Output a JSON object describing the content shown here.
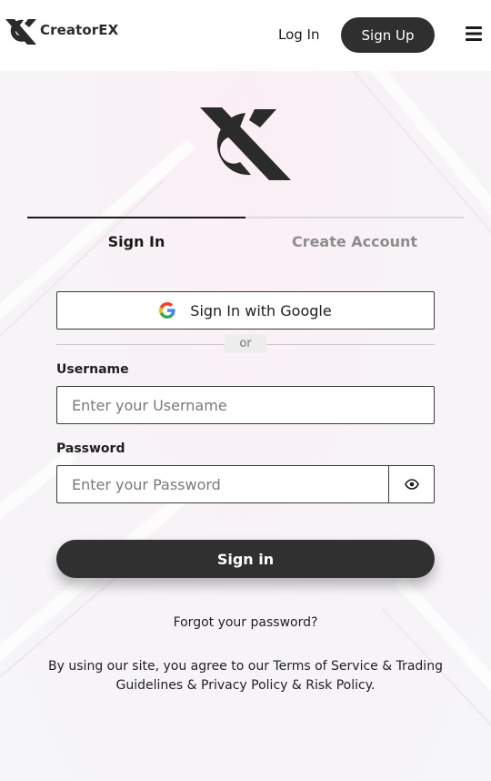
{
  "header": {
    "brand_name": "CreatorEX",
    "login_label": "Log In",
    "signup_label": "Sign Up"
  },
  "tabs": [
    {
      "label": "Sign In",
      "active": true
    },
    {
      "label": "Create Account",
      "active": false
    }
  ],
  "form": {
    "google_label": "Sign In with Google",
    "or_label": "or",
    "username_label": "Username",
    "username_placeholder": "Enter your Username",
    "username_value": "",
    "password_label": "Password",
    "password_placeholder": "Enter your Password",
    "password_value": "",
    "submit_label": "Sign in",
    "forgot_label": "Forgot your password?"
  },
  "legal": {
    "prefix": "By using our site, you agree to our ",
    "terms": "Terms of Service & Trading Guidelines",
    "sep1": " & ",
    "privacy": "Privacy Policy",
    "sep2": " & ",
    "risk": "Risk Policy",
    "suffix": "."
  },
  "colors": {
    "primary_dark": "#2f2f2f",
    "muted_tab": "#8c8c8c",
    "background_tint": "#f8f2f6"
  },
  "icons": {
    "brand": "creatorex-logo-icon",
    "menu": "hamburger-menu-icon",
    "google": "google-icon",
    "eye": "eye-icon"
  }
}
